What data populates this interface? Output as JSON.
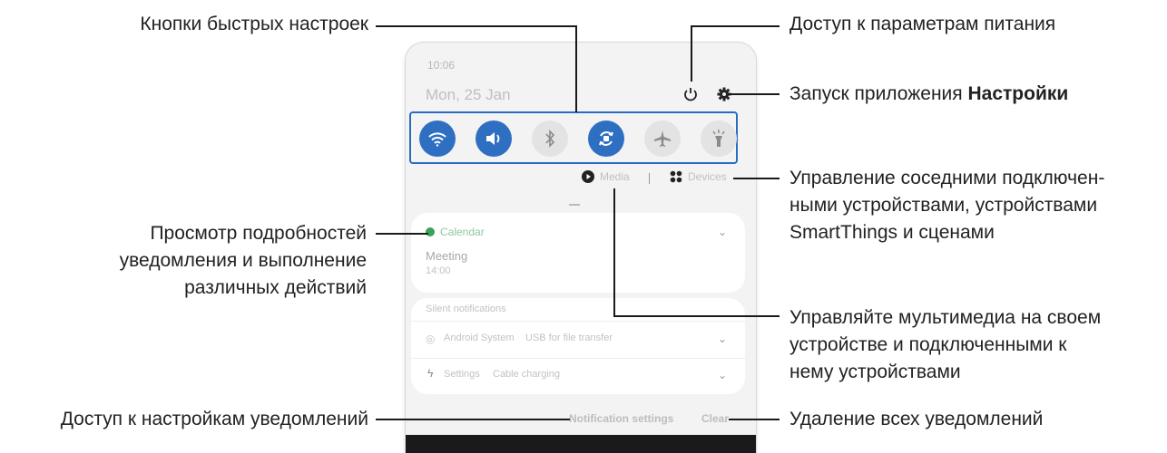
{
  "callouts": {
    "quick_settings": "Кнопки быстрых настроек",
    "power": "Доступ к параметрам питания",
    "settings_prefix": "Запуск приложения ",
    "settings_bold": "Настройки",
    "devices_line1": "Управление соседними подключен-",
    "devices_line2": "ными устройствами, устройствами",
    "devices_line3": "SmartThings и сценами",
    "details_line1": "Просмотр подробностей",
    "details_line2": "уведомления и выполнение",
    "details_line3": "различных действий",
    "media_line1": "Управляйте мультимедиа на своем",
    "media_line2": "устройстве и подключенными к",
    "media_line3": "нему устройствами",
    "notif_settings": "Доступ к настройкам уведомлений",
    "clear_all": "Удаление всех уведомлений"
  },
  "panel": {
    "time": "10:06",
    "date": "Mon, 25 Jan",
    "media_label": "Media",
    "devices_label": "Devices",
    "calendar_app": "Calendar",
    "event_title": "Meeting",
    "event_time": "14:00",
    "silent_header": "Silent notifications",
    "android_row_app": "Android System",
    "android_row_text": "USB for file transfer",
    "settings_row_app": "Settings",
    "settings_row_text": "Cable charging",
    "notif_settings_btn": "Notification settings",
    "clear_btn": "Clear"
  },
  "quick_toggles": [
    {
      "name": "wifi-icon",
      "state": "on"
    },
    {
      "name": "sound-icon",
      "state": "on"
    },
    {
      "name": "bluetooth-icon",
      "state": "off"
    },
    {
      "name": "auto-rotate-icon",
      "state": "on"
    },
    {
      "name": "airplane-icon",
      "state": "off"
    },
    {
      "name": "flashlight-icon",
      "state": "off"
    }
  ],
  "colors": {
    "accent": "#2f6fc2",
    "text": "#222222"
  }
}
